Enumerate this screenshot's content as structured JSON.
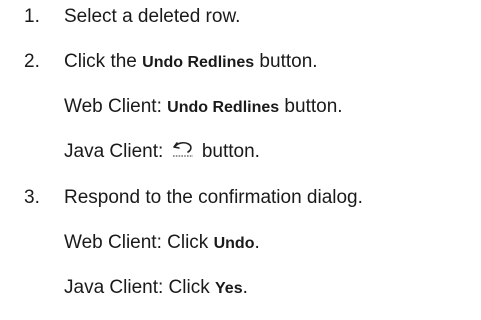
{
  "steps": [
    {
      "number": "1.",
      "text": "Select a deleted row."
    },
    {
      "number": "2.",
      "before": "Click the ",
      "ui": "Undo Redlines",
      "after": " button.",
      "web_client": {
        "prefix": "Web Client: ",
        "ui": "Undo Redlines",
        "suffix": " button."
      },
      "java_client": {
        "prefix": "Java Client: ",
        "icon": "undo-icon",
        "suffix": " button."
      }
    },
    {
      "number": "3.",
      "text": "Respond to the confirmation dialog.",
      "web_client": {
        "prefix": "Web Client: Click ",
        "ui": "Undo",
        "suffix": "."
      },
      "java_client": {
        "prefix": "Java Client: Click ",
        "ui": "Yes",
        "suffix": "."
      }
    }
  ]
}
